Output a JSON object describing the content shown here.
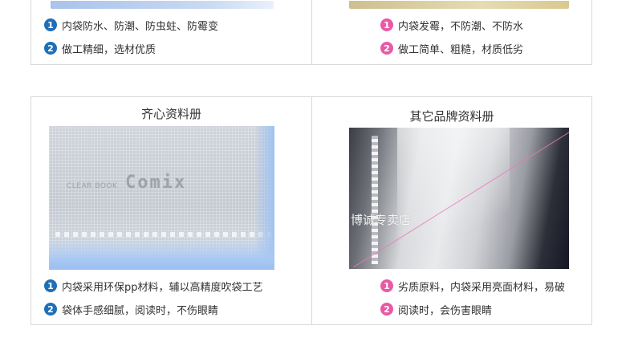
{
  "top_left": {
    "bullets": [
      {
        "num": "1",
        "text": "内袋防水、防潮、防虫蛀、防霉变"
      },
      {
        "num": "2",
        "text": "做工精细，选材优质"
      }
    ]
  },
  "top_right": {
    "bullets": [
      {
        "num": "1",
        "text": "内袋发霉，不防潮、不防水"
      },
      {
        "num": "2",
        "text": "做工简单、粗糙，材质低劣"
      }
    ]
  },
  "bottom_left": {
    "title": "齐心资料册",
    "image": {
      "clear_book": "CLEAR BOOK",
      "brand": "Comix"
    },
    "bullets": [
      {
        "num": "1",
        "text": "内袋采用环保pp材料，辅以高精度吹袋工艺"
      },
      {
        "num": "2",
        "text": "袋体手感细腻，阅读时，不伤眼睛"
      }
    ]
  },
  "bottom_right": {
    "title": "其它品牌资料册",
    "image": {
      "watermark": "博诚专卖店"
    },
    "bullets": [
      {
        "num": "1",
        "text": "劣质原料，内袋采用亮面材料，易破"
      },
      {
        "num": "2",
        "text": "阅读时，会伤害眼睛"
      }
    ]
  },
  "colors": {
    "badge_blue": "#1f6fb8",
    "badge_pink": "#e85aa6",
    "border": "#d9d9d9"
  }
}
